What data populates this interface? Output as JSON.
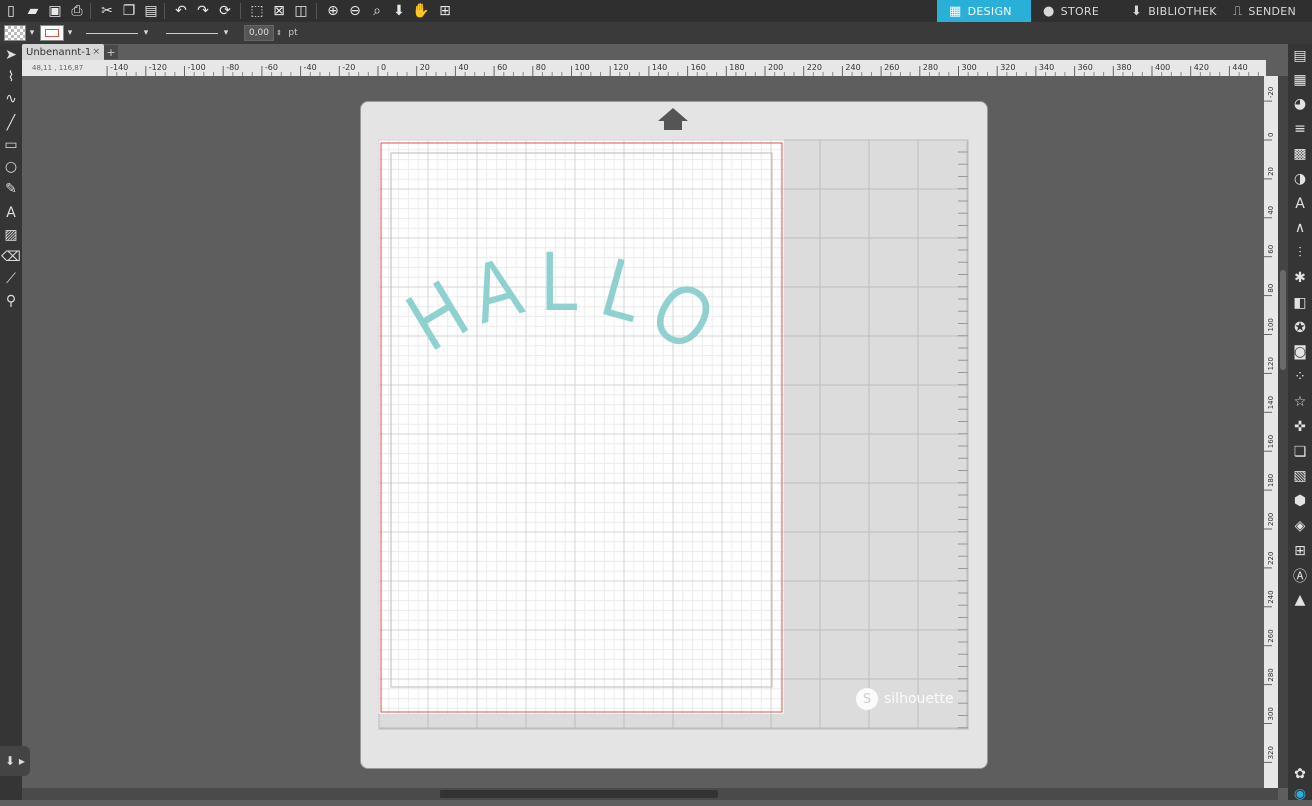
{
  "nav": {
    "tabs": [
      {
        "label": "DESIGN",
        "icon": "design-grid-icon"
      },
      {
        "label": "STORE",
        "icon": "store-s-icon"
      },
      {
        "label": "BIBLIOTHEK",
        "icon": "library-download-icon"
      },
      {
        "label": "SENDEN",
        "icon": "send-cutter-icon"
      }
    ],
    "active": "DESIGN"
  },
  "toolbar": {
    "icons": [
      "new-doc-icon",
      "open-folder-icon",
      "save-icon",
      "print-icon",
      "cut-icon",
      "copy-icon",
      "paste-icon",
      "undo-icon",
      "redo-icon",
      "redraw-icon",
      "select-all-icon",
      "deselect-icon",
      "replicate-icon",
      "zoom-in-icon",
      "zoom-out-icon",
      "zoom-fit-icon",
      "move-down-icon",
      "pan-hand-icon",
      "fit-page-icon"
    ]
  },
  "options": {
    "line_width_value": "0,00",
    "line_width_unit": "pt"
  },
  "document": {
    "tab_label": "Unbenannt-1",
    "close_label": "×",
    "add_label": "+"
  },
  "ruler": {
    "cursor_coords": "48,11 , 116,87",
    "h_ticks": [
      "-140",
      "-120",
      "-100",
      "-80",
      "-60",
      "-40",
      "-20",
      "0",
      "20",
      "40",
      "60",
      "80",
      "100",
      "120",
      "140",
      "160",
      "180",
      "200",
      "220",
      "240",
      "260",
      "280",
      "300",
      "320",
      "340",
      "360",
      "380",
      "400",
      "420",
      "440"
    ],
    "v_ticks": [
      "-20",
      "0",
      "20",
      "40",
      "60",
      "80",
      "100",
      "120",
      "140",
      "160",
      "180",
      "200",
      "220",
      "240",
      "260",
      "280",
      "300",
      "320"
    ]
  },
  "canvas": {
    "text": "HALLO",
    "text_color": "#8fd1cf",
    "cut_border_color": "#e0524a",
    "brand": "silhouette"
  },
  "left_tools": [
    "select-arrow-icon",
    "point-edit-icon",
    "curve-icon",
    "line-icon",
    "rectangle-icon",
    "ellipse-icon",
    "pencil-icon",
    "text-icon",
    "fill-icon",
    "eraser-icon",
    "knife-icon",
    "eyedropper-icon"
  ],
  "right_tools": [
    "page-setup-icon",
    "registration-icon",
    "fill-panel-icon",
    "line-style-icon",
    "fill-pattern-icon",
    "contrast-icon",
    "text-style-icon",
    "transform-icon",
    "align-icon",
    "replicate-icon",
    "modify-icon",
    "offset-icon",
    "trace-icon",
    "sketch-icon",
    "star-icon",
    "puzzle-icon",
    "layers-icon",
    "hatch-icon",
    "rhinestone-icon",
    "emboss-icon",
    "print-cut-icon",
    "text-to-path-icon",
    "image-effects-icon"
  ],
  "colors": {
    "accent": "#29b0d8"
  }
}
